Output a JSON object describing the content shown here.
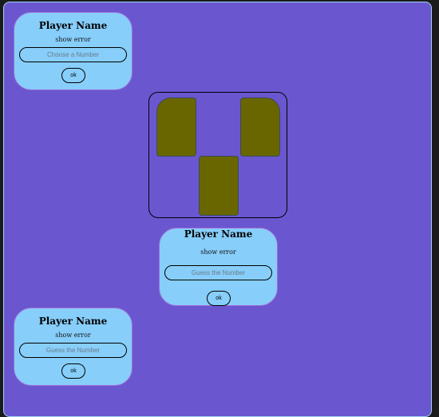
{
  "colors": {
    "stage": "#6a57d0",
    "card": "#87cefa",
    "tile": "#696600"
  },
  "cards": {
    "top_left": {
      "player_name": "Player Name",
      "error": "show error",
      "placeholder": "Choose a Number",
      "ok_label": "ok"
    },
    "center": {
      "player_name": "Player Name",
      "error": "show error",
      "placeholder": "Guess the Number",
      "ok_label": "ok"
    },
    "bottom_left": {
      "player_name": "Player Name",
      "error": "show error",
      "placeholder": "Guess the Number",
      "ok_label": "ok"
    }
  }
}
